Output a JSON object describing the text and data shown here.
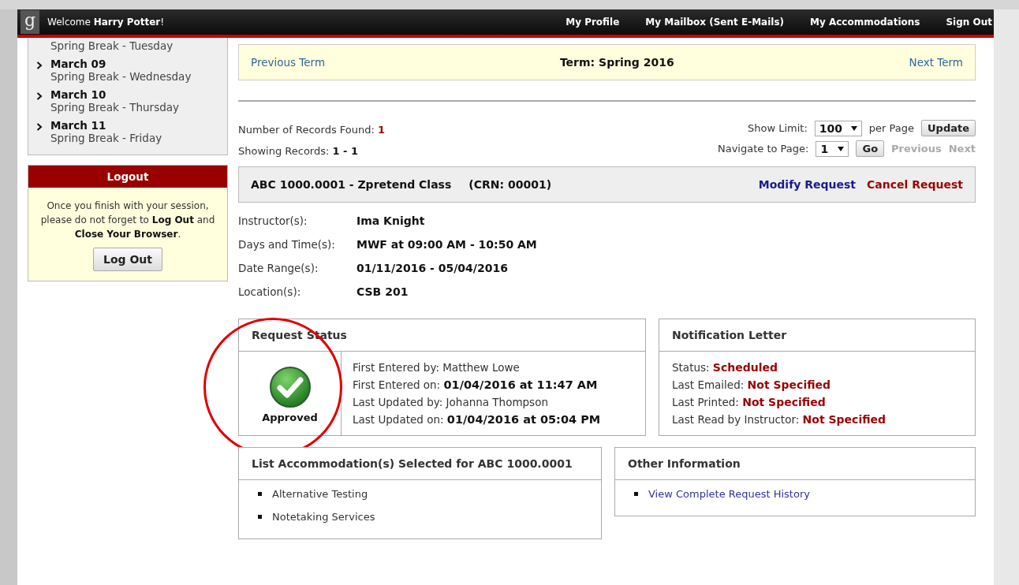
{
  "header": {
    "logo": "g",
    "welcome": "Welcome **Harry Potter**!",
    "nav": [
      {
        "label": "My Profile"
      },
      {
        "label": "My Mailbox (Sent E-Mails)"
      },
      {
        "label": "My Accommodations"
      },
      {
        "label": "Sign Out"
      }
    ]
  },
  "sidebar": {
    "calendar": [
      {
        "label": "Spring Break - Tuesday"
      },
      {
        "date": "March 09",
        "label": "Spring Break - Wednesday"
      },
      {
        "date": "March 10",
        "label": "Spring Break - Thursday"
      },
      {
        "date": "March 11",
        "label": "Spring Break - Friday"
      }
    ],
    "logout": {
      "title": "Logout",
      "message": "Once you finish with your session, please do not forget to **Log Out** and **Close Your Browser**.",
      "button": "Log Out"
    }
  },
  "term_bar": {
    "previous": "Previous Term",
    "title": "Term: Spring 2016",
    "next": "Next Term"
  },
  "records": {
    "found": "Number of Records Found: **1**",
    "showing": "Showing Records: **1 - 1**",
    "show_limit": {
      "label": "Show Limit:",
      "value": "100",
      "suffix": "per Page",
      "button": "Update"
    },
    "navigate": {
      "label": "Navigate to Page:",
      "value": "1",
      "button": "Go",
      "previous": {
        "label": "Previous",
        "disabled": true
      },
      "next": {
        "label": "Next",
        "disabled": true
      }
    }
  },
  "course": {
    "title": "ABC 1000.0001 - Zpretend Class",
    "crn": "(CRN: 00001)",
    "actions": [
      {
        "label": "Modify Request",
        "kind": "modify"
      },
      {
        "label": "Cancel Request",
        "kind": "cancel"
      }
    ]
  },
  "details": [
    {
      "label": "Instructor(s):",
      "value": "Ima Knight"
    },
    {
      "label": "Days and Time(s):",
      "value": "MWF at 09:00 AM - 10:50 AM"
    },
    {
      "label": "Date Range(s):",
      "value": "01/11/2016 - 05/04/2016"
    },
    {
      "label": "Location(s):",
      "value": "CSB 201"
    }
  ],
  "request_status": {
    "title": "Request Status",
    "status": "Approved",
    "highlighted": true,
    "lines": [
      "First Entered by: Matthew Lowe",
      "First Entered on: **01/04/2016 at 11:47 AM**",
      "Last Updated by: Johanna Thompson",
      "Last Updated on: **01/04/2016 at 05:04 PM**"
    ]
  },
  "notification_letter": {
    "title": "Notification Letter",
    "lines": [
      "Status: **Scheduled**",
      "Last Emailed: **Not Specified**",
      "Last Printed: **Not Specified**",
      "Last Read by Instructor: **Not Specified**"
    ]
  },
  "accommodations": {
    "title": "List Accommodation(s) Selected for ABC 1000.0001",
    "items": [
      "Alternative Testing",
      "Notetaking Services"
    ]
  },
  "other_information": {
    "title": "Other Information",
    "links": [
      "View Complete Request History"
    ]
  }
}
